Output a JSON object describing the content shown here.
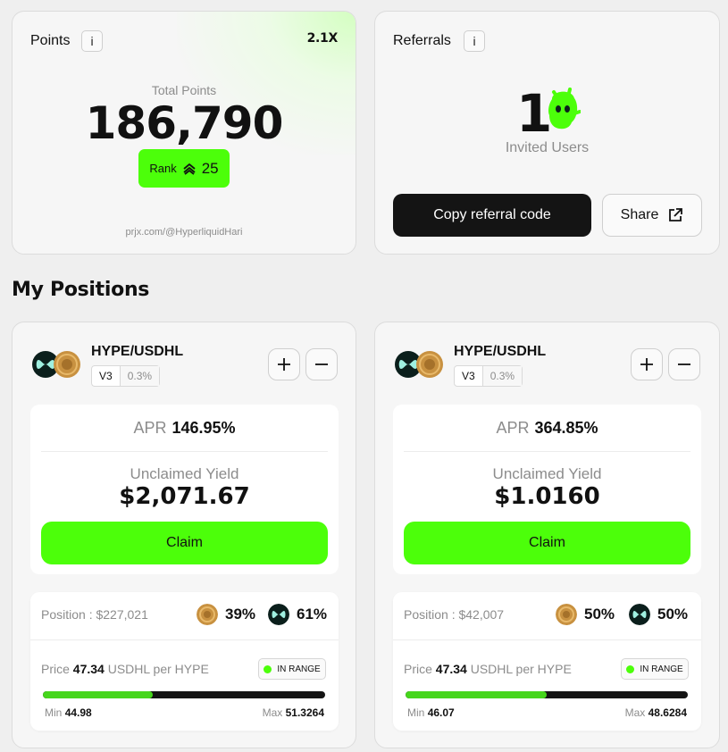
{
  "points": {
    "title": "Points",
    "info_label": "i",
    "multiplier": "2.1X",
    "total_label": "Total Points",
    "total_value": "186,790",
    "rank_label": "Rank",
    "rank_value": "25",
    "profile_link": "prjx.com/@HyperliquidHari"
  },
  "referrals": {
    "title": "Referrals",
    "info_label": "i",
    "invited_count": "1",
    "invited_label": "Invited Users",
    "copy_button": "Copy referral code",
    "share_button": "Share"
  },
  "positions_heading": "My Positions",
  "positions": [
    {
      "pair": "HYPE/USDHL",
      "version": "V3",
      "fee": "0.3%",
      "apr_label": "APR",
      "apr": "146.95%",
      "unclaimed_label": "Unclaimed Yield",
      "unclaimed": "$2,071.67",
      "claim_button": "Claim",
      "position_label": "Position : $227,021",
      "usdhl_pct": "39%",
      "hype_pct": "61%",
      "price_prefix": "Price",
      "price": "47.34",
      "price_suffix": "USDHL per HYPE",
      "status": "IN RANGE",
      "range_fill_fraction": 0.39,
      "min_label": "Min",
      "min": "44.98",
      "max_label": "Max",
      "max": "51.3264"
    },
    {
      "pair": "HYPE/USDHL",
      "version": "V3",
      "fee": "0.3%",
      "apr_label": "APR",
      "apr": "364.85%",
      "unclaimed_label": "Unclaimed Yield",
      "unclaimed": "$1.0160",
      "claim_button": "Claim",
      "position_label": "Position : $42,007",
      "usdhl_pct": "50%",
      "hype_pct": "50%",
      "price_prefix": "Price",
      "price": "47.34",
      "price_suffix": "USDHL per HYPE",
      "status": "IN RANGE",
      "range_fill_fraction": 0.5,
      "min_label": "Min",
      "min": "46.07",
      "max_label": "Max",
      "max": "48.6284"
    }
  ],
  "colors": {
    "accent": "#4cff0a",
    "range_fill": "#46d61c",
    "dark": "#141414",
    "hype_token": "#0b1f1c",
    "usdhl_token": "#c89140"
  },
  "icons": [
    "info-icon",
    "rank-chevrons-icon",
    "mascot-icon",
    "external-link-icon",
    "hype-token-icon",
    "usdhl-token-icon",
    "plus-icon",
    "minus-icon",
    "status-dot-icon"
  ]
}
